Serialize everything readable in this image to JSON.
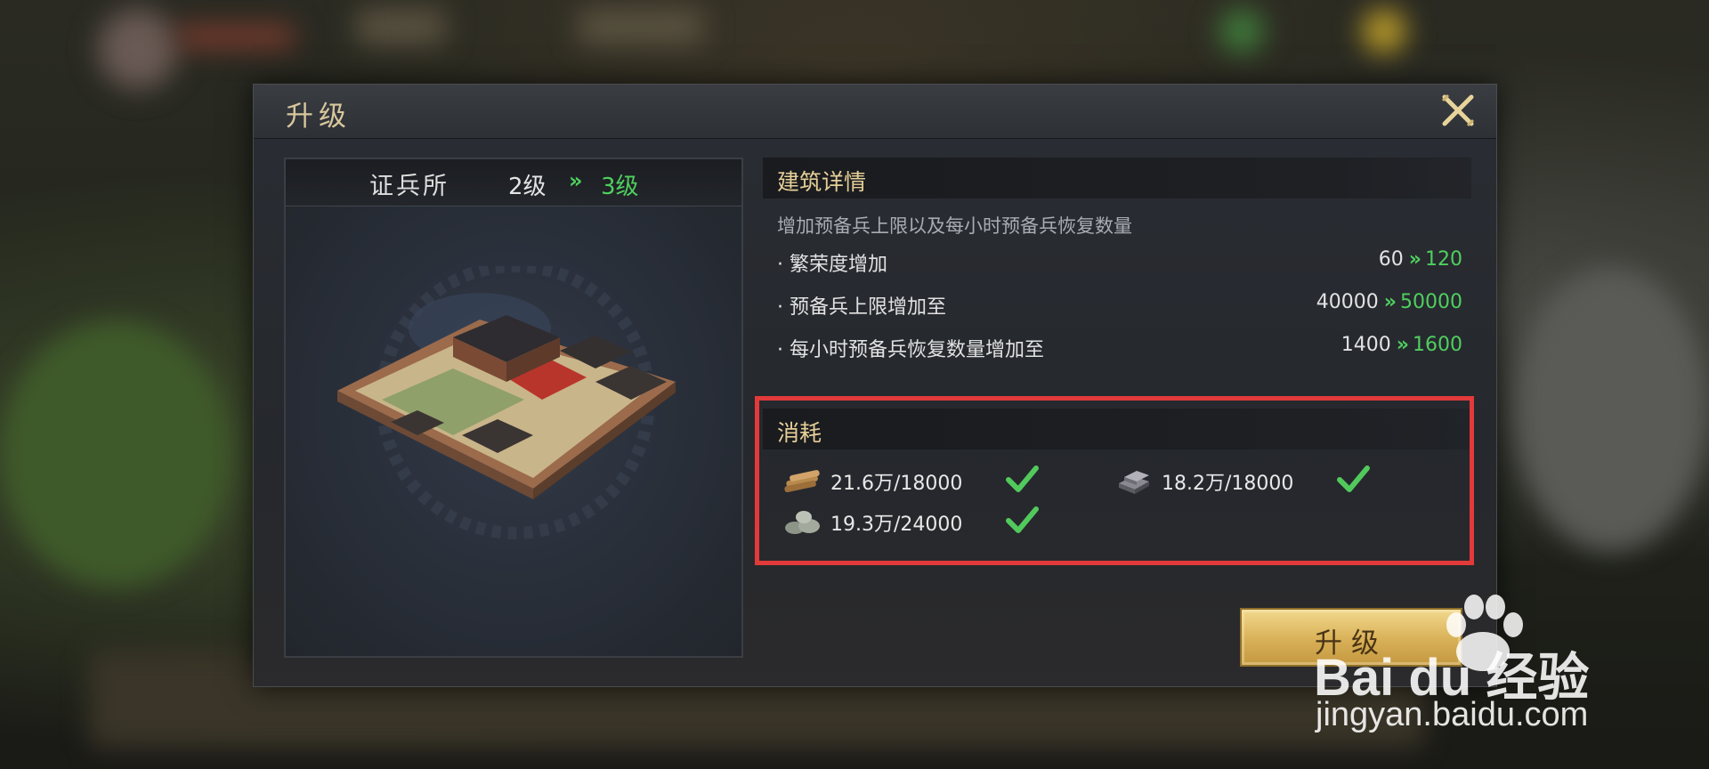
{
  "dialog": {
    "title": "升级",
    "close_icon": "close-x-icon"
  },
  "building": {
    "name": "证兵所",
    "level_from": "2级",
    "level_to": "3级",
    "arrow": "»"
  },
  "details": {
    "section_title": "建筑详情",
    "description": "增加预备兵上限以及每小时预备兵恢复数量",
    "rows": [
      {
        "label": "· 繁荣度增加",
        "from": "60",
        "to": "120"
      },
      {
        "label": "· 预备兵上限增加至",
        "from": "40000",
        "to": "50000"
      },
      {
        "label": "· 每小时预备兵恢复数量增加至",
        "from": "1400",
        "to": "1600"
      }
    ]
  },
  "cost": {
    "section_title": "消耗",
    "items": [
      {
        "icon": "wood-icon",
        "text": "21.6万/18000",
        "satisfied": true
      },
      {
        "icon": "iron-icon",
        "text": "18.2万/18000",
        "satisfied": true
      },
      {
        "icon": "stone-icon",
        "text": "19.3万/24000",
        "satisfied": true
      }
    ]
  },
  "upgrade_button": {
    "label": "升级"
  },
  "watermark": {
    "brand": "Bai du 经验",
    "url": "jingyan.baidu.com"
  },
  "colors": {
    "accent_green": "#4fcf5e",
    "gold": "#e6cf98",
    "highlight_red": "#e23a3a"
  }
}
